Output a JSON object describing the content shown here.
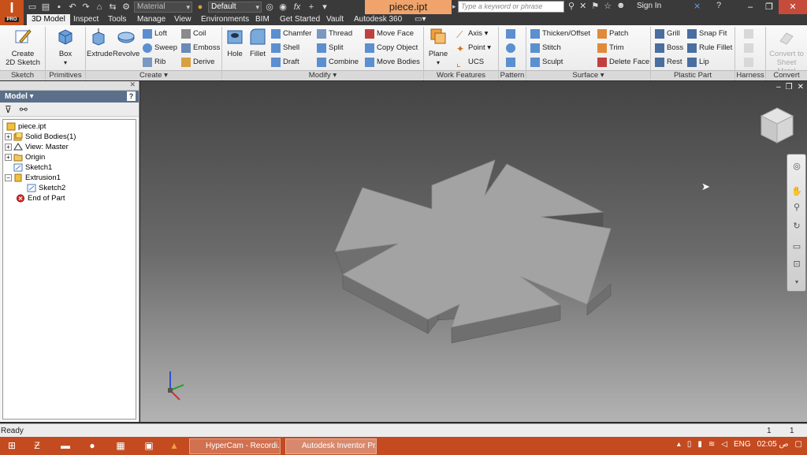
{
  "titlebar": {
    "app_letter": "I",
    "app_pro": "PRO",
    "material_placeholder": "Material",
    "appearance_value": "Default",
    "formula_label": "fx",
    "document_title": "piece.ipt",
    "search_placeholder": "Type a keyword or phrase",
    "sign_in": "Sign In"
  },
  "tabs": [
    "3D Model",
    "Inspect",
    "Tools",
    "Manage",
    "View",
    "Environments",
    "BIM",
    "Get Started",
    "Vault",
    "Autodesk 360"
  ],
  "ribbon": {
    "sketch": {
      "create": "Create",
      "create2": "2D Sketch",
      "panel": "Sketch"
    },
    "primitives": {
      "box": "Box",
      "panel": "Primitives"
    },
    "create": {
      "extrude": "Extrude",
      "revolve": "Revolve",
      "loft": "Loft",
      "coil": "Coil",
      "sweep": "Sweep",
      "emboss": "Emboss",
      "rib": "Rib",
      "derive": "Derive",
      "panel": "Create"
    },
    "modify": {
      "hole": "Hole",
      "fillet": "Fillet",
      "chamfer": "Chamfer",
      "thread": "Thread",
      "move_face": "Move Face",
      "shell": "Shell",
      "split": "Split",
      "copy_object": "Copy Object",
      "draft": "Draft",
      "combine": "Combine",
      "move_bodies": "Move Bodies",
      "panel": "Modify"
    },
    "work": {
      "plane": "Plane",
      "axis": "Axis",
      "point": "Point",
      "ucs": "UCS",
      "panel": "Work Features"
    },
    "pattern": {
      "panel": "Pattern"
    },
    "surface": {
      "thicken": "Thicken/Offset",
      "patch": "Patch",
      "stitch": "Stitch",
      "trim": "Trim",
      "sculpt": "Sculpt",
      "delete_face": "Delete Face",
      "panel": "Surface"
    },
    "plastic": {
      "grill": "Grill",
      "snap_fit": "Snap Fit",
      "boss": "Boss",
      "rule_fillet": "Rule Fillet",
      "rest": "Rest",
      "lip": "Lip",
      "panel": "Plastic Part"
    },
    "harness": {
      "panel": "Harness"
    },
    "convert": {
      "label1": "Convert to",
      "label2": "Sheet Metal",
      "panel": "Convert"
    }
  },
  "browser": {
    "title": "Model",
    "nodes": [
      {
        "label": "piece.ipt"
      },
      {
        "label": "Solid Bodies(1)"
      },
      {
        "label": "View: Master"
      },
      {
        "label": "Origin"
      },
      {
        "label": "Sketch1"
      },
      {
        "label": "Extrusion1"
      },
      {
        "label": "Sketch2"
      },
      {
        "label": "End of Part"
      }
    ]
  },
  "status": {
    "text": "Ready",
    "count1": "1",
    "count2": "1"
  },
  "taskbar": {
    "task1": "HyperCam - Recordi...",
    "task2": "Autodesk Inventor Pr...",
    "lang": "ENG",
    "time": "02:05 ص"
  },
  "colors": {
    "accent": "#c44a1f",
    "doc_tab": "#f0a36a",
    "part_top": "#a3a3a3",
    "part_side": "#6f6f6f"
  }
}
